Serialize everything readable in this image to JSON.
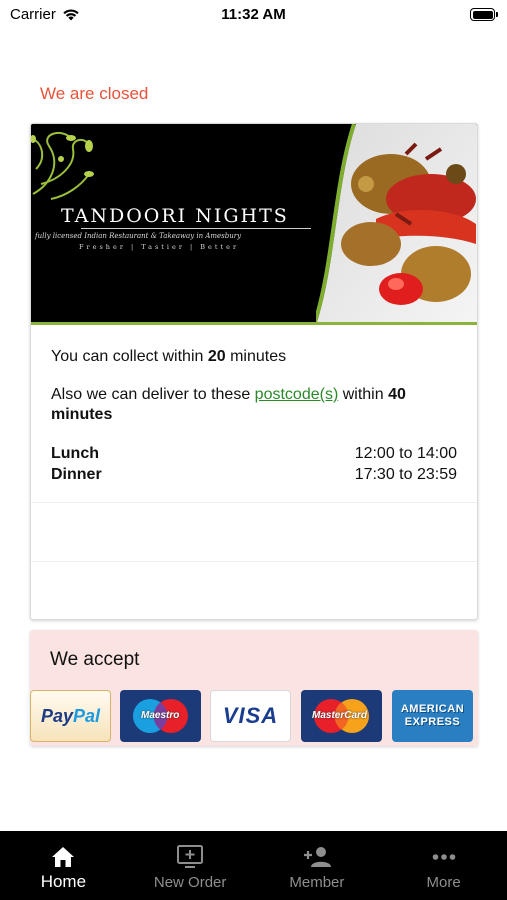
{
  "status_bar": {
    "carrier": "Carrier",
    "time": "11:32 AM"
  },
  "notice": {
    "closed_text": "We are closed",
    "color": "#e8523a"
  },
  "restaurant": {
    "logo_text": "TANDOORI NIGHTS",
    "subtitle": "fully licensed Indian Restaurant & Takeaway in Amesbury",
    "tagline": "Fresher | Tastier | Better"
  },
  "info": {
    "collect_prefix": "You can collect within",
    "collect_minutes": "20",
    "collect_suffix": "minutes",
    "deliver_prefix": "Also we can deliver to these",
    "deliver_link": "postcode(s)",
    "deliver_middle": "within",
    "deliver_minutes": "40",
    "deliver_suffix": "minutes",
    "link_color": "#2a8a2a"
  },
  "hours": [
    {
      "name": "Lunch",
      "time": "12:00 to 14:00"
    },
    {
      "name": "Dinner",
      "time": "17:30 to 23:59"
    }
  ],
  "payments": {
    "heading": "We accept",
    "background": "#fbe3e1",
    "cards": {
      "paypal_a": "Pay",
      "paypal_b": "Pal",
      "maestro": "Maestro",
      "visa": "VISA",
      "mastercard": "MasterCard",
      "amex_line1": "AMERICAN",
      "amex_line2": "EXPRESS"
    }
  },
  "tab_bar": {
    "active": "home",
    "tabs": [
      {
        "id": "home",
        "label": "Home",
        "icon": "home-icon"
      },
      {
        "id": "new-order",
        "label": "New Order",
        "icon": "add-box-icon"
      },
      {
        "id": "member",
        "label": "Member",
        "icon": "add-person-icon"
      },
      {
        "id": "more",
        "label": "More",
        "icon": "more-dots-icon"
      }
    ]
  }
}
